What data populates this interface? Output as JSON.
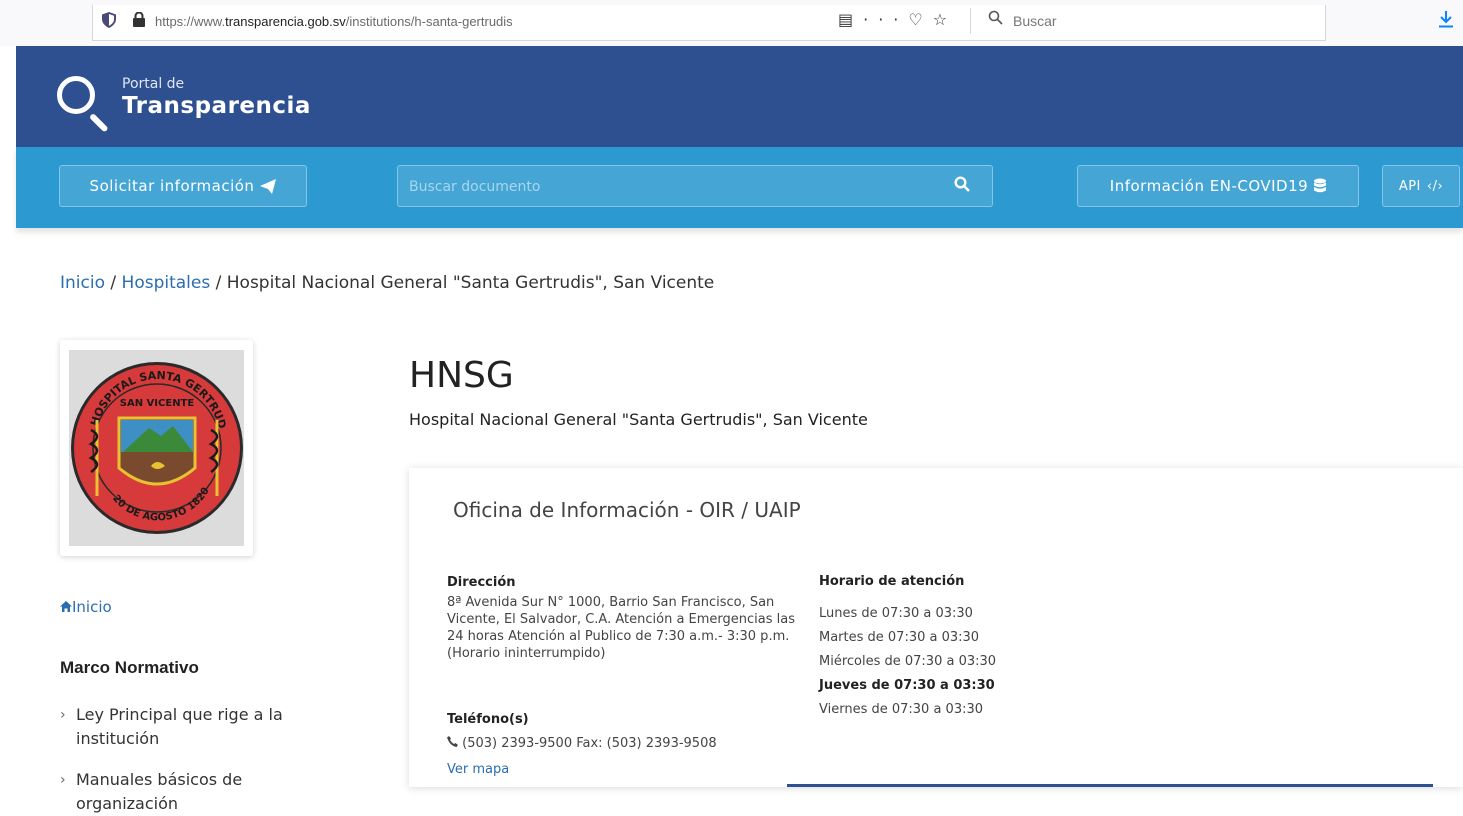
{
  "browser": {
    "url_prefix": "https://www.",
    "url_domain": "transparencia.gob.sv",
    "url_path": "/institutions/h-santa-gertrudis",
    "search_placeholder": "Buscar"
  },
  "header": {
    "logo_small": "Portal de",
    "logo_big": "Transparencia"
  },
  "nav": {
    "request_label": "Solicitar información",
    "search_placeholder": "Buscar documento",
    "covid_label": "Información EN-COVID19",
    "api_label": "API"
  },
  "breadcrumb": {
    "home": "Inicio",
    "sep1": " / ",
    "section": "Hospitales",
    "sep2": " / ",
    "current": "Hospital Nacional General \"Santa Gertrudis\", San Vicente"
  },
  "emblem": {
    "top_text": "HOSPITAL SANTA GERTRUDIS",
    "mid_text": "SAN VICENTE",
    "bottom_text": "20 DE AGOSTO 1820"
  },
  "sidebar": {
    "home": "Inicio",
    "section_title": "Marco Normativo",
    "items": [
      {
        "label": "Ley Principal que rige a la institución"
      },
      {
        "label": "Manuales básicos de organización"
      }
    ]
  },
  "institution": {
    "abbr": "HNSG",
    "full_name": "Hospital Nacional General \"Santa Gertrudis\", San Vicente"
  },
  "office": {
    "title": "Oficina de Información - OIR / UAIP",
    "address_label": "Dirección",
    "address": "8ª Avenida Sur N° 1000, Barrio San Francisco, San Vicente, El Salvador, C.A. Atención a Emergencias las 24 horas Atención al Publico de 7:30 a.m.- 3:30 p.m. (Horario ininterrumpido)",
    "phone_label": "Teléfono(s)",
    "phone": "(503) 2393-9500 Fax: (503) 2393-9508",
    "map_link": "Ver mapa",
    "hours_label": "Horario de atención",
    "hours": [
      "Lunes de 07:30 a 03:30",
      "Martes de 07:30 a 03:30",
      "Miércoles de 07:30 a 03:30",
      "Jueves de 07:30 a 03:30",
      "Viernes de 07:30 a 03:30"
    ]
  },
  "colors": {
    "header_bg": "#2f5090",
    "nav_bg": "#2c9ad1",
    "link": "#2a6db0"
  }
}
